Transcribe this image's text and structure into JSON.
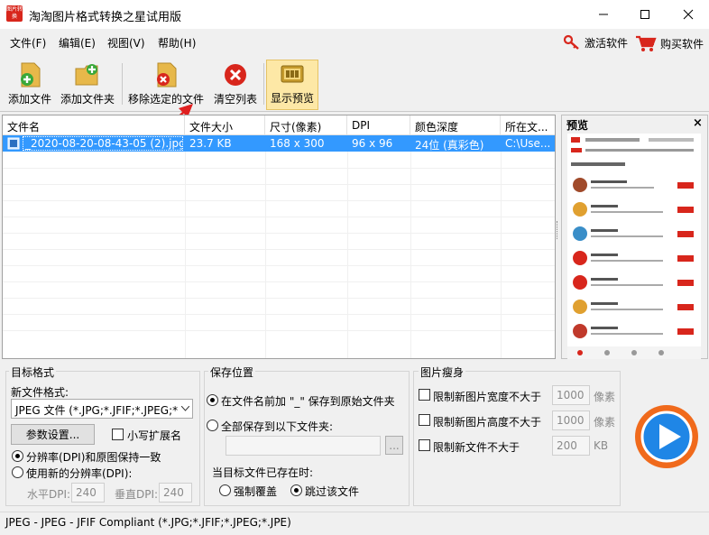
{
  "window": {
    "title": "淘淘图片格式转换之星试用版",
    "icon_text": "图片转换"
  },
  "menu": [
    {
      "label": "文件(F)"
    },
    {
      "label": "编辑(E)"
    },
    {
      "label": "视图(V)"
    },
    {
      "label": "帮助(H)"
    }
  ],
  "header_links": {
    "activate": "激活软件",
    "buy": "购买软件"
  },
  "toolbar": {
    "add_file": "添加文件",
    "add_folder": "添加文件夹",
    "remove_selected": "移除选定的文件",
    "clear_list": "清空列表",
    "show_preview": "显示预览"
  },
  "file_list": {
    "columns": [
      "文件名",
      "文件大小",
      "尺寸(像素)",
      "DPI",
      "颜色深度",
      "所在文..."
    ],
    "rows": [
      {
        "name": "_2020-08-20-08-43-05 (2).jpg",
        "size": "23.7 KB",
        "dims": "168 x 300",
        "dpi": "96 x 96",
        "depth": "24位 (真彩色)",
        "path": "C:\\Use..."
      }
    ]
  },
  "preview": {
    "title": "预览",
    "close": "×"
  },
  "target_format": {
    "group": "目标格式",
    "new_format_label": "新文件格式:",
    "format_value": "JPEG 文件 (*.JPG;*.JFIF;*.JPEG;*",
    "settings_button": "参数设置...",
    "lowercase_ext": "小写扩展名",
    "dpi_keep": "分辨率(DPI)和原图保持一致",
    "dpi_new": "使用新的分辨率(DPI):",
    "h_dpi_label": "水平DPI:",
    "h_dpi_value": "240",
    "v_dpi_label": "垂直DPI:",
    "v_dpi_value": "240"
  },
  "save_location": {
    "group": "保存位置",
    "option_prefix": "在文件名前加 \"_\" 保存到原始文件夹",
    "option_folder": "全部保存到以下文件夹:",
    "browse": "...",
    "exists_label": "当目标文件已存在时:",
    "overwrite": "强制覆盖",
    "skip": "跳过该文件"
  },
  "slim": {
    "group": "图片瘦身",
    "limit_width": "限制新图片宽度不大于",
    "width_value": "1000",
    "width_unit": "像素",
    "limit_height": "限制新图片高度不大于",
    "height_value": "1000",
    "height_unit": "像素",
    "limit_size": "限制新文件不大于",
    "size_value": "200",
    "size_unit": "KB"
  },
  "status": "JPEG - JPEG - JFIF Compliant (*.JPG;*.JFIF;*.JPEG;*.JPE)",
  "colors": {
    "selection": "#3399ff",
    "accent_red": "#d8261c",
    "start_orange": "#f06a1c",
    "start_blue": "#1f86e6"
  }
}
